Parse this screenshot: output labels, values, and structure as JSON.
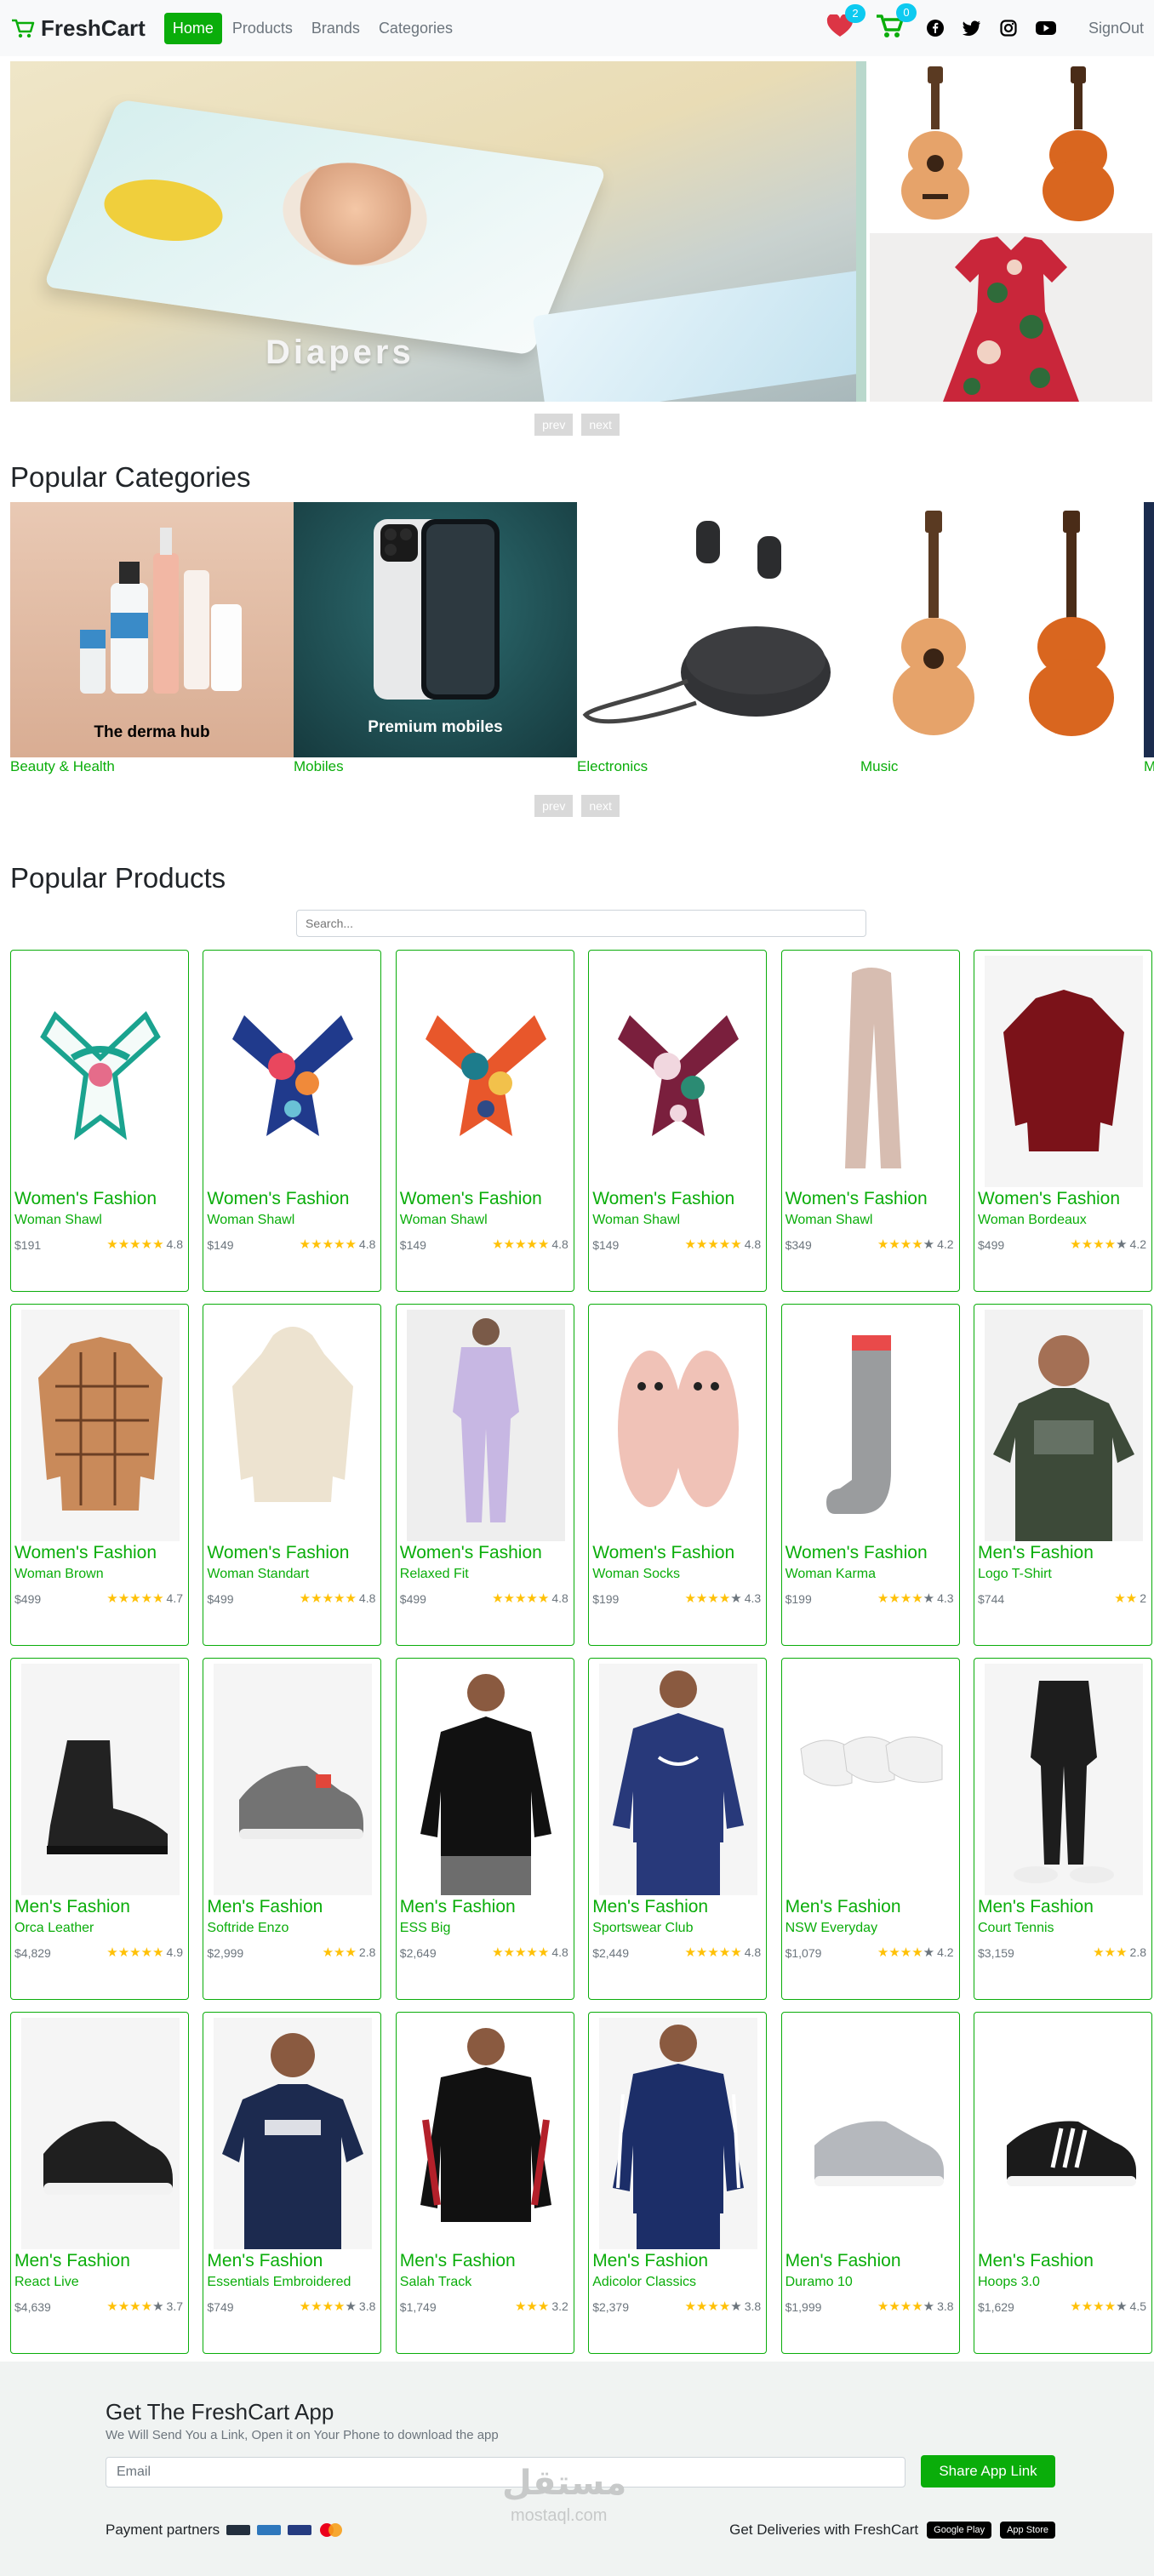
{
  "colors": {
    "brand": "#0aad0a",
    "badge_wishlist": "#0dcaf0",
    "badge_cart": "#0dcaf0",
    "navbar_bg": "#f8f9fa",
    "star": "#ffc107"
  },
  "navbar": {
    "brand": "FreshCart",
    "links": [
      "Home",
      "Products",
      "Brands",
      "Categories"
    ],
    "active_link": "Home",
    "wishlist_count": "2",
    "cart_count": "0",
    "social_icons": [
      "facebook-icon",
      "twitter-icon",
      "instagram-icon",
      "youtube-icon"
    ],
    "signout_label": "SignOut"
  },
  "hero": {
    "caption": "Diapers",
    "prev_label": "prev",
    "next_label": "next"
  },
  "categories": {
    "title": "Popular Categories",
    "items": [
      {
        "label": "Beauty & Health",
        "caption": "The derma hub"
      },
      {
        "label": "Mobiles",
        "caption": "Premium mobiles"
      },
      {
        "label": "Electronics",
        "caption": ""
      },
      {
        "label": "Music",
        "caption": ""
      },
      {
        "label": "M",
        "caption": ""
      }
    ],
    "prev_label": "prev",
    "next_label": "next"
  },
  "products": {
    "title": "Popular Products",
    "search_placeholder": "Search...",
    "items": [
      {
        "category": "Women's Fashion",
        "name": "Woman Shawl",
        "price": "$191",
        "rating": "4.8",
        "stars": 5,
        "image": "scarf-teal"
      },
      {
        "category": "Women's Fashion",
        "name": "Woman Shawl",
        "price": "$149",
        "rating": "4.8",
        "stars": 5,
        "image": "scarf-navy"
      },
      {
        "category": "Women's Fashion",
        "name": "Woman Shawl",
        "price": "$149",
        "rating": "4.8",
        "stars": 5,
        "image": "scarf-orange"
      },
      {
        "category": "Women's Fashion",
        "name": "Woman Shawl",
        "price": "$149",
        "rating": "4.8",
        "stars": 5,
        "image": "scarf-burgundy"
      },
      {
        "category": "Women's Fashion",
        "name": "Woman Shawl",
        "price": "$349",
        "rating": "4.2",
        "stars": 4,
        "image": "scarf-beige"
      },
      {
        "category": "Women's Fashion",
        "name": "Woman Bordeaux",
        "price": "$499",
        "rating": "4.2",
        "stars": 4,
        "image": "shirt-bordeaux"
      },
      {
        "category": "Women's Fashion",
        "name": "Woman Brown",
        "price": "$499",
        "rating": "4.7",
        "stars": 5,
        "image": "shirt-check"
      },
      {
        "category": "Women's Fashion",
        "name": "Woman Standart",
        "price": "$499",
        "rating": "4.8",
        "stars": 5,
        "image": "hoodie-cream"
      },
      {
        "category": "Women's Fashion",
        "name": "Relaxed Fit",
        "price": "$499",
        "rating": "4.8",
        "stars": 5,
        "image": "pants-lilac"
      },
      {
        "category": "Women's Fashion",
        "name": "Woman Socks",
        "price": "$199",
        "rating": "4.3",
        "stars": 4,
        "image": "slippers-pink"
      },
      {
        "category": "Women's Fashion",
        "name": "Woman Karma",
        "price": "$199",
        "rating": "4.3",
        "stars": 4,
        "image": "sock-gray"
      },
      {
        "category": "Men's Fashion",
        "name": "Logo T-Shirt",
        "price": "$744",
        "rating": "2",
        "stars": 2,
        "image": "tshirt-olive"
      },
      {
        "category": "Men's Fashion",
        "name": "Orca Leather",
        "price": "$4,829",
        "rating": "4.9",
        "stars": 5,
        "image": "boot-black"
      },
      {
        "category": "Men's Fashion",
        "name": "Softride Enzo",
        "price": "$2,999",
        "rating": "2.8",
        "stars": 3,
        "image": "sneaker-gray"
      },
      {
        "category": "Men's Fashion",
        "name": "ESS Big",
        "price": "$2,649",
        "rating": "4.8",
        "stars": 5,
        "image": "hoodie-black"
      },
      {
        "category": "Men's Fashion",
        "name": "Sportswear Club",
        "price": "$2,449",
        "rating": "4.8",
        "stars": 5,
        "image": "hoodie-navy"
      },
      {
        "category": "Men's Fashion",
        "name": "NSW Everyday",
        "price": "$1,079",
        "rating": "4.2",
        "stars": 4,
        "image": "socks-white"
      },
      {
        "category": "Men's Fashion",
        "name": "Court Tennis",
        "price": "$3,159",
        "rating": "2.8",
        "stars": 3,
        "image": "pants-black"
      },
      {
        "category": "Men's Fashion",
        "name": "React Live",
        "price": "$4,639",
        "rating": "3.7",
        "stars": 4,
        "image": "sneaker-black"
      },
      {
        "category": "Men's Fashion",
        "name": "Essentials Embroidered",
        "price": "$749",
        "rating": "3.8",
        "stars": 4,
        "image": "tshirt-navy"
      },
      {
        "category": "Men's Fashion",
        "name": "Salah Track",
        "price": "$1,749",
        "rating": "3.2",
        "stars": 3,
        "image": "jacket-black"
      },
      {
        "category": "Men's Fashion",
        "name": "Adicolor Classics",
        "price": "$2,379",
        "rating": "3.8",
        "stars": 4,
        "image": "jacket-navy"
      },
      {
        "category": "Men's Fashion",
        "name": "Duramo 10",
        "price": "$1,999",
        "rating": "3.8",
        "stars": 4,
        "image": "sneaker-silver"
      },
      {
        "category": "Men's Fashion",
        "name": "Hoops 3.0",
        "price": "$1,629",
        "rating": "4.5",
        "stars": 4,
        "image": "sneaker-court"
      }
    ]
  },
  "footer": {
    "title": "Get The FreshCart App",
    "subtitle": "We Will Send You a Link, Open it on Your Phone to download the app",
    "email_placeholder": "Email",
    "share_label": "Share App Link",
    "partners_label": "Payment partners",
    "deliveries_label": "Get Deliveries with FreshCart",
    "google_play": "Google Play",
    "app_store": "App Store",
    "watermark": "مستقل",
    "watermark_sub": "mostaql.com"
  }
}
